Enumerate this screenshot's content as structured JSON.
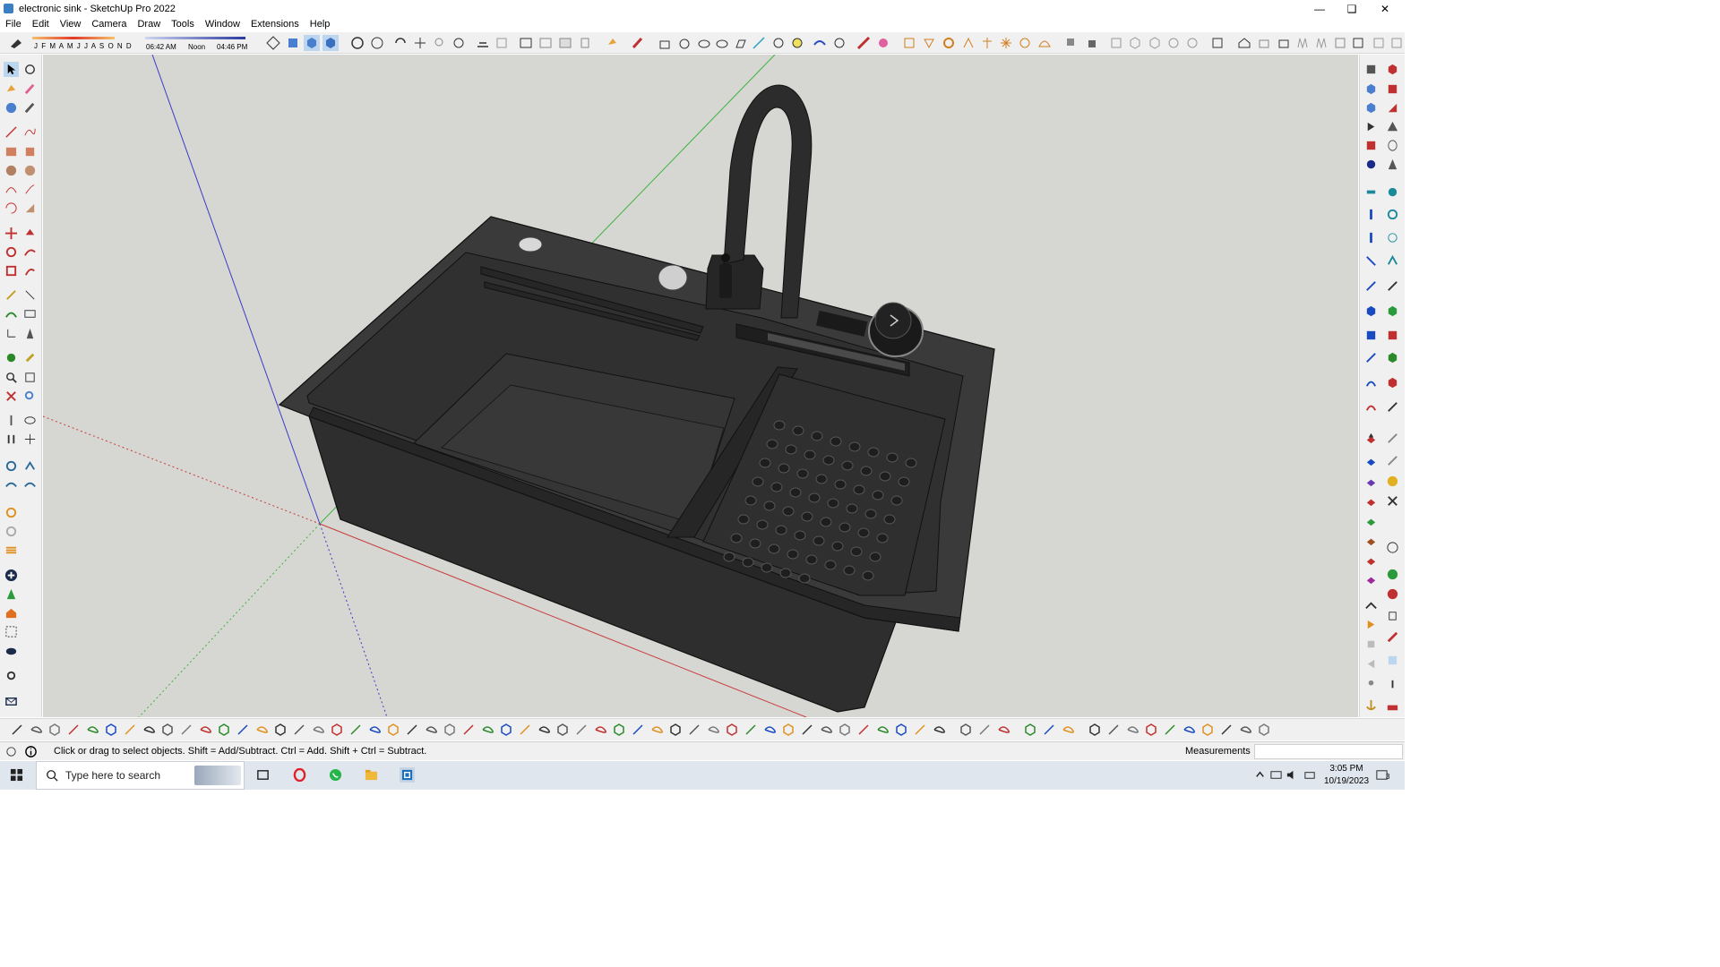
{
  "window": {
    "title": "electronic sink - SketchUp Pro 2022",
    "controls": [
      "minimize-icon",
      "maximize-icon",
      "close-icon"
    ]
  },
  "menu": [
    "File",
    "Edit",
    "View",
    "Camera",
    "Draw",
    "Tools",
    "Window",
    "Extensions",
    "Help"
  ],
  "shadow_settings": {
    "months": "J F M A M J J A S O N D",
    "time_start": "06:42 AM",
    "time_noon": "Noon",
    "time_end": "04:46 PM"
  },
  "status": {
    "hint": "Click or drag to select objects. Shift = Add/Subtract. Ctrl = Add. Shift + Ctrl = Subtract.",
    "measurements_label": "Measurements",
    "measurements_value": ""
  },
  "taskbar": {
    "search_placeholder": "Type here to search",
    "time": "3:05 PM",
    "date": "10/19/2023",
    "notifications": "3",
    "apps": [
      "start-icon",
      "task-view-icon",
      "opera-icon",
      "whatsapp-icon",
      "file-explorer-icon",
      "sketchup-icon"
    ]
  },
  "model": {
    "name": "electronic sink",
    "sink_color": "#3c3c3c",
    "background_color": "#d6d6d2",
    "axis_colors": {
      "red": "#c83c3c",
      "green": "#3cb43c",
      "blue": "#3c3cc8"
    }
  }
}
